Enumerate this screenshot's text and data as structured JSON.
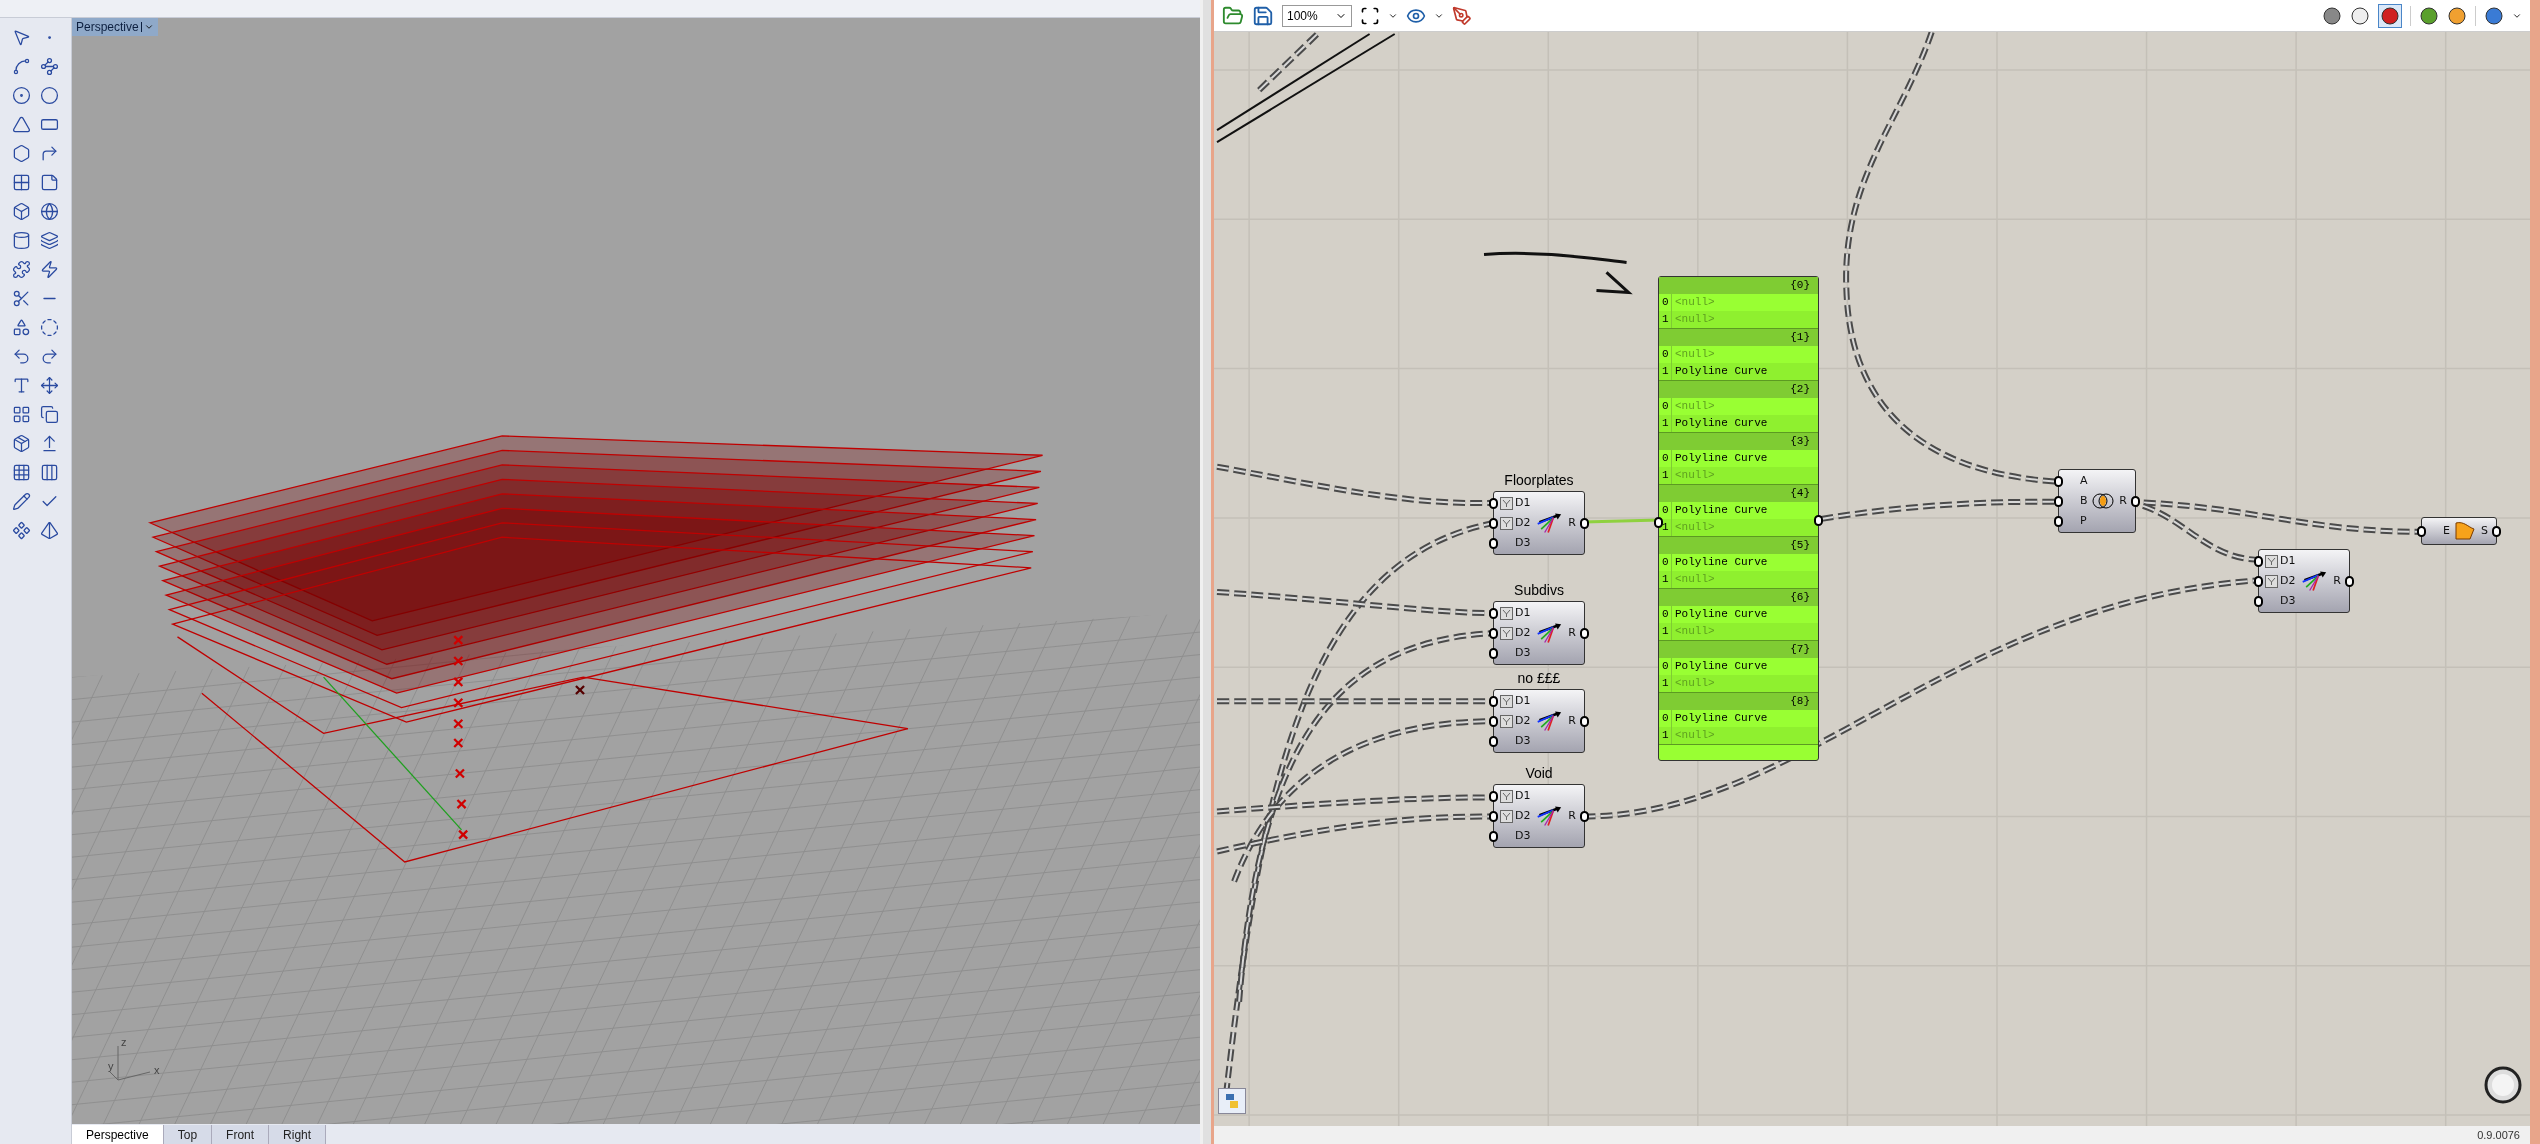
{
  "rhino": {
    "viewport_tab": {
      "label": "Perspective"
    },
    "axis_labels": [
      "z",
      "y",
      "x"
    ],
    "view_tabs": [
      {
        "label": "Perspective",
        "selected": true
      },
      {
        "label": "Top",
        "selected": false
      },
      {
        "label": "Front",
        "selected": false
      },
      {
        "label": "Right",
        "selected": false
      }
    ]
  },
  "grasshopper": {
    "toolbar": {
      "zoom": "100%"
    },
    "components": [
      {
        "kind": "tree",
        "label": "Floorplates",
        "inputs": [
          {
            "name": "D1",
            "flattened": true
          },
          {
            "name": "D2",
            "flattened": true
          },
          {
            "name": "D3",
            "flattened": false
          }
        ],
        "outputs": [
          "R"
        ]
      },
      {
        "kind": "tree",
        "label": "Subdivs",
        "inputs": [
          {
            "name": "D1",
            "flattened": true
          },
          {
            "name": "D2",
            "flattened": true
          },
          {
            "name": "D3",
            "flattened": false
          }
        ],
        "outputs": [
          "R"
        ]
      },
      {
        "kind": "tree",
        "label": "no £££",
        "inputs": [
          {
            "name": "D1",
            "flattened": true
          },
          {
            "name": "D2",
            "flattened": true
          },
          {
            "name": "D3",
            "flattened": false
          }
        ],
        "outputs": [
          "R"
        ]
      },
      {
        "kind": "tree",
        "label": "Void",
        "inputs": [
          {
            "name": "D1",
            "flattened": true
          },
          {
            "name": "D2",
            "flattened": true
          },
          {
            "name": "D3",
            "flattened": false
          }
        ],
        "outputs": [
          "R"
        ]
      },
      {
        "kind": "region",
        "inputs": [
          {
            "name": "A",
            "flattened": false
          },
          {
            "name": "B",
            "flattened": false
          },
          {
            "name": "P",
            "flattened": false
          }
        ],
        "outputs": [
          "R"
        ]
      },
      {
        "kind": "surface",
        "inputs": [
          {
            "name": "E",
            "flattened": false
          }
        ],
        "outputs": [
          "S"
        ]
      },
      {
        "kind": "tree",
        "inputs": [
          {
            "name": "D1",
            "flattened": true
          },
          {
            "name": "D2",
            "flattened": true
          },
          {
            "name": "D3",
            "flattened": false
          }
        ],
        "outputs": [
          "R"
        ]
      }
    ],
    "panel": {
      "branches": [
        {
          "path": "{0}",
          "items": [
            {
              "index": "0",
              "value": "<null>",
              "kind": "null"
            },
            {
              "index": "1",
              "value": "<null>",
              "kind": "null"
            }
          ]
        },
        {
          "path": "{1}",
          "items": [
            {
              "index": "0",
              "value": "<null>",
              "kind": "null"
            },
            {
              "index": "1",
              "value": "Polyline Curve",
              "kind": "value"
            }
          ]
        },
        {
          "path": "{2}",
          "items": [
            {
              "index": "0",
              "value": "<null>",
              "kind": "null"
            },
            {
              "index": "1",
              "value": "Polyline Curve",
              "kind": "value"
            }
          ]
        },
        {
          "path": "{3}",
          "items": [
            {
              "index": "0",
              "value": "Polyline Curve",
              "kind": "value"
            },
            {
              "index": "1",
              "value": "<null>",
              "kind": "null"
            }
          ]
        },
        {
          "path": "{4}",
          "items": [
            {
              "index": "0",
              "value": "Polyline Curve",
              "kind": "value"
            },
            {
              "index": "1",
              "value": "<null>",
              "kind": "null"
            }
          ]
        },
        {
          "path": "{5}",
          "items": [
            {
              "index": "0",
              "value": "Polyline Curve",
              "kind": "value"
            },
            {
              "index": "1",
              "value": "<null>",
              "kind": "null"
            }
          ]
        },
        {
          "path": "{6}",
          "items": [
            {
              "index": "0",
              "value": "Polyline Curve",
              "kind": "value"
            },
            {
              "index": "1",
              "value": "<null>",
              "kind": "null"
            }
          ]
        },
        {
          "path": "{7}",
          "items": [
            {
              "index": "0",
              "value": "Polyline Curve",
              "kind": "value"
            },
            {
              "index": "1",
              "value": "<null>",
              "kind": "null"
            }
          ]
        },
        {
          "path": "{8}",
          "items": [
            {
              "index": "0",
              "value": "Polyline Curve",
              "kind": "value"
            },
            {
              "index": "1",
              "value": "<null>",
              "kind": "null"
            }
          ]
        }
      ]
    },
    "version": "0.9.0076"
  }
}
